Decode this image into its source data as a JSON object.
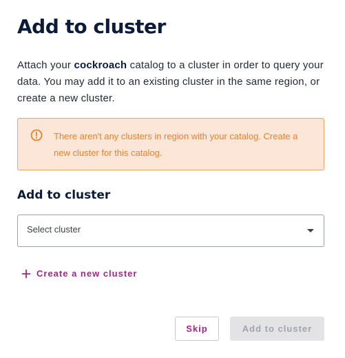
{
  "dialog": {
    "title": "Add to cluster",
    "description": {
      "before": "Attach your ",
      "catalog_name": "cockroach",
      "after": " catalog to a cluster in order to query your data. You may add it to an existing cluster in the same region, or create a new cluster."
    },
    "alert": {
      "icon": "warning-circle-icon",
      "text": "There aren't any clusters in region with your catalog. Create a new cluster for this catalog.",
      "color": "#e8822a",
      "background": "#fce6d8"
    },
    "section_title": "Add to cluster",
    "cluster_select": {
      "placeholder": "Select cluster",
      "value": ""
    },
    "create_link": {
      "icon": "plus-icon",
      "label": "Create a new cluster"
    },
    "buttons": {
      "skip": "Skip",
      "add": "Add to cluster"
    },
    "accent_color": "#a3238e"
  }
}
